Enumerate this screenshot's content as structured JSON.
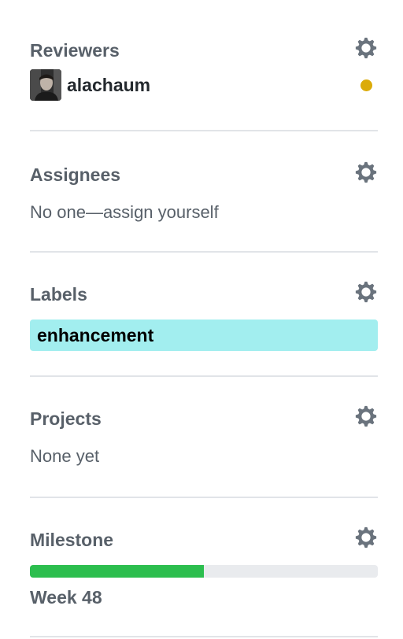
{
  "reviewers": {
    "title": "Reviewers",
    "items": [
      {
        "name": "alachaum",
        "status_color": "#dbab09"
      }
    ]
  },
  "assignees": {
    "title": "Assignees",
    "empty_text": "No one—assign yourself"
  },
  "labels": {
    "title": "Labels",
    "items": [
      {
        "name": "enhancement",
        "color": "#a2eeef"
      }
    ]
  },
  "projects": {
    "title": "Projects",
    "empty_text": "None yet"
  },
  "milestone": {
    "title": "Milestone",
    "name": "Week 48",
    "progress_fraction": 0.5,
    "progress_color": "#2cbe4e"
  },
  "icons": {
    "settings": "gear-icon",
    "avatar": "user-avatar-photo"
  },
  "colors": {
    "heading": "#586069",
    "divider": "#e1e4e8",
    "gear": "#6a737d"
  }
}
